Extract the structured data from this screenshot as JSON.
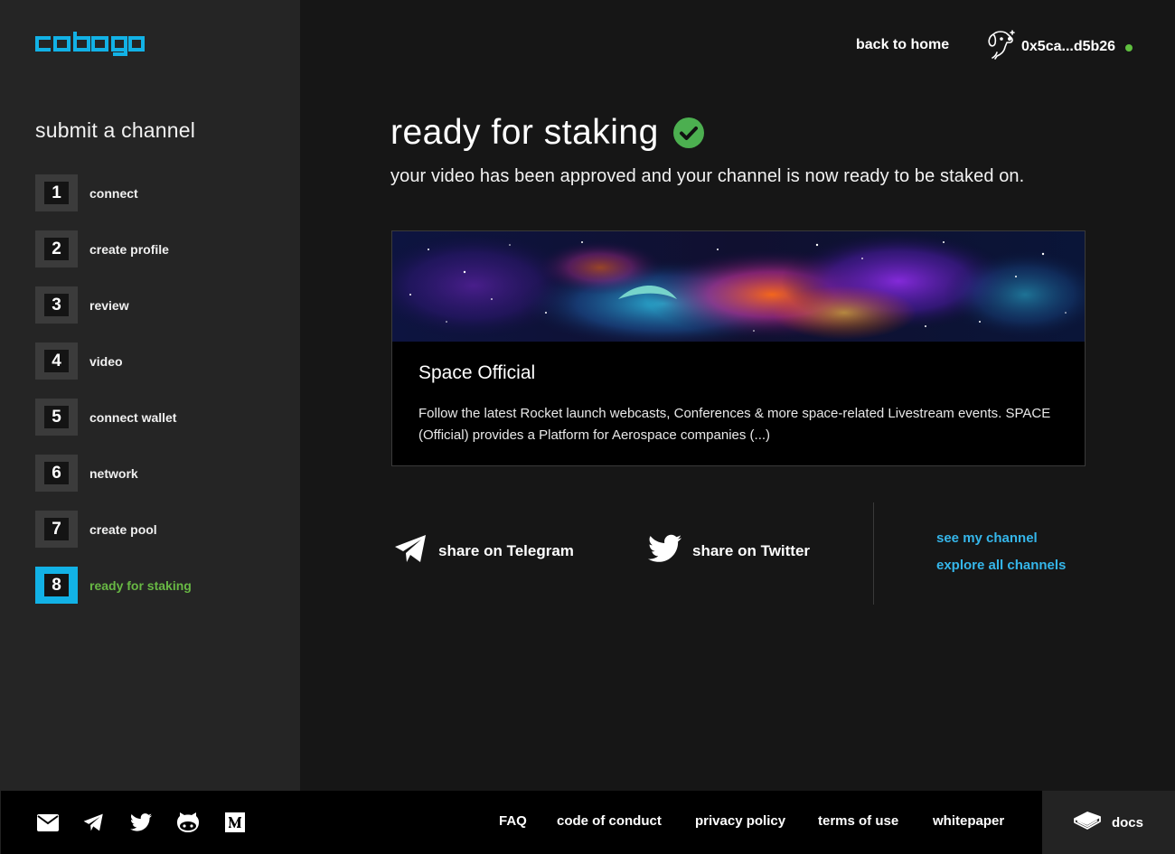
{
  "brand": {
    "logo_text": "cobogo",
    "accent": "#12b2e6"
  },
  "sidebar": {
    "title": "submit a channel",
    "steps": [
      {
        "num": "1",
        "label": "connect"
      },
      {
        "num": "2",
        "label": "create profile"
      },
      {
        "num": "3",
        "label": "review"
      },
      {
        "num": "4",
        "label": "video"
      },
      {
        "num": "5",
        "label": "connect wallet"
      },
      {
        "num": "6",
        "label": "network"
      },
      {
        "num": "7",
        "label": "create pool"
      },
      {
        "num": "8",
        "label": "ready for staking",
        "active": true
      }
    ]
  },
  "header": {
    "back_link": "back to home",
    "wallet_address": "0x5ca...d5b26",
    "wallet_status_color": "#5fbf3f"
  },
  "main": {
    "title": "ready for staking",
    "subtitle": "your video has been approved and your channel is now ready to be staked on.",
    "success_color": "#4caf50",
    "channel": {
      "name": "Space Official",
      "description": "Follow the latest Rocket launch webcasts, Conferences & more space-related Livestream events. SPACE (Official) provides a Platform for Aerospace companies (...)"
    },
    "share": {
      "telegram_label": "share on Telegram",
      "twitter_label": "share on Twitter"
    },
    "links": {
      "my_channel": "see my channel",
      "explore": "explore all channels"
    }
  },
  "footer": {
    "icons": [
      "mail-icon",
      "telegram-icon",
      "twitter-icon",
      "github-icon",
      "medium-icon"
    ],
    "links": [
      "FAQ",
      "code of conduct",
      "privacy policy",
      "terms of use",
      "whitepaper"
    ],
    "docs_label": "docs"
  }
}
